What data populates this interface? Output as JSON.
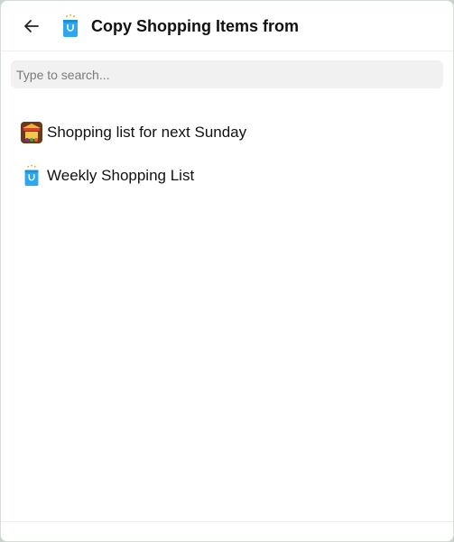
{
  "header": {
    "title": "Copy Shopping Items from",
    "back_icon": "arrow-left-icon",
    "title_icon": "shopping-bag-icon"
  },
  "search": {
    "placeholder": "Type to search...",
    "value": ""
  },
  "lists": [
    {
      "label": "Shopping list for next Sunday",
      "icon": "market-stall-icon"
    },
    {
      "label": "Weekly Shopping List",
      "icon": "shopping-bag-icon"
    }
  ],
  "colors": {
    "bag_blue": "#2ea7ee",
    "bag_handle": "#1b6fa8",
    "sparkle": "#e0b22a"
  }
}
